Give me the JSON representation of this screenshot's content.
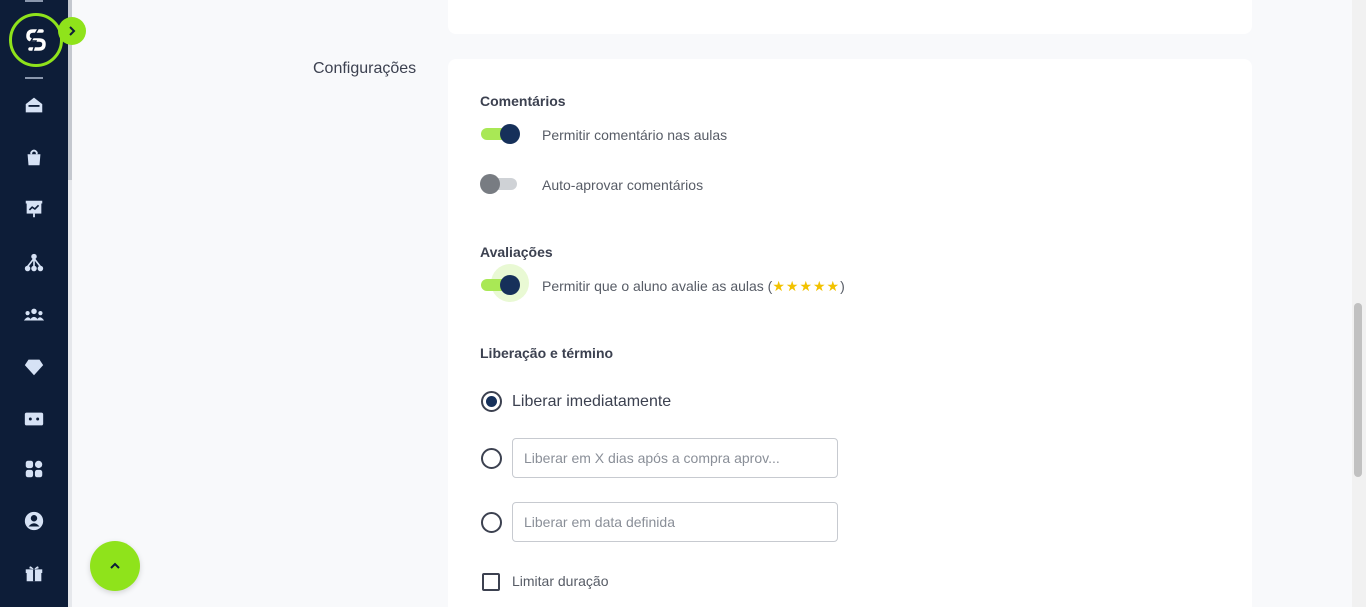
{
  "sidebar": {
    "items": [
      {
        "icon": "home-icon"
      },
      {
        "icon": "shopping-bag-icon"
      },
      {
        "icon": "presentation-icon"
      },
      {
        "icon": "network-icon"
      },
      {
        "icon": "users-icon"
      },
      {
        "icon": "diamond-icon"
      },
      {
        "icon": "ticket-icon"
      },
      {
        "icon": "apps-icon"
      },
      {
        "icon": "user-circle-icon"
      },
      {
        "icon": "gift-icon"
      }
    ],
    "accent_color": "#8fe31b",
    "background_color": "#0d1d38"
  },
  "main": {
    "section_title": "Configurações",
    "comments": {
      "heading": "Comentários",
      "allow_label": "Permitir comentário nas aulas",
      "allow_enabled": true,
      "auto_approve_label": "Auto-aprovar comentários",
      "auto_approve_enabled": false
    },
    "ratings": {
      "heading": "Avaliações",
      "allow_label_prefix": "Permitir que o aluno avalie as aulas (",
      "stars": "★★★★★",
      "allow_label_suffix": ")",
      "allow_enabled": true
    },
    "release": {
      "heading": "Liberação e término",
      "options": [
        {
          "label": "Liberar imediatamente",
          "selected": true
        },
        {
          "placeholder": "Liberar em X dias após a compra aprov...",
          "value": "",
          "selected": false
        },
        {
          "placeholder": "Liberar em data definida",
          "value": "",
          "selected": false
        }
      ],
      "limit_duration_label": "Limitar duração",
      "limit_duration_checked": false
    }
  }
}
